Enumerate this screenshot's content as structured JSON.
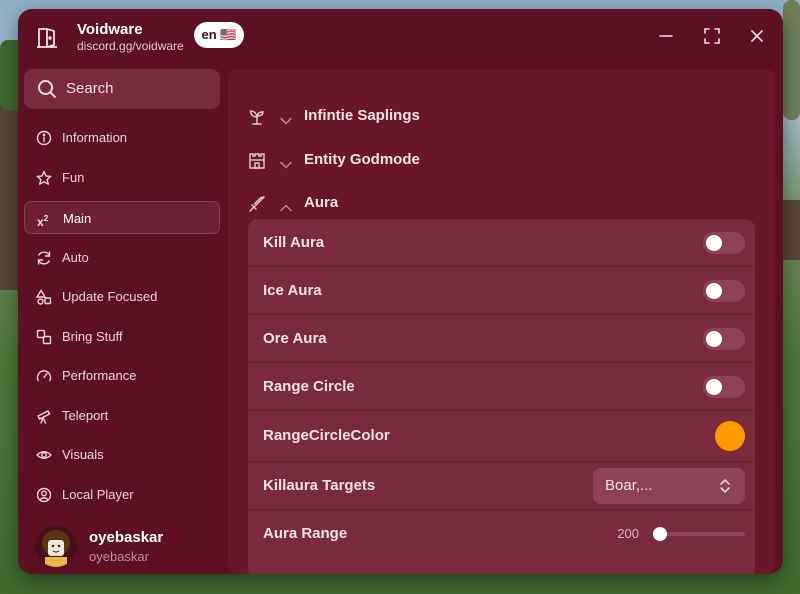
{
  "app": {
    "title": "Voidware",
    "subtitle": "discord.gg/voidware",
    "language": "en 🇺🇸"
  },
  "sidebar": {
    "search_placeholder": "Search",
    "items": [
      {
        "label": "Information",
        "icon": "info-icon"
      },
      {
        "label": "Fun",
        "icon": "star-icon"
      },
      {
        "label": "Main",
        "icon": "x2-icon",
        "active": true
      },
      {
        "label": "Auto",
        "icon": "refresh-icon"
      },
      {
        "label": "Update Focused",
        "icon": "shapes-icon"
      },
      {
        "label": "Bring Stuff",
        "icon": "boxes-icon"
      },
      {
        "label": "Performance",
        "icon": "gauge-icon"
      },
      {
        "label": "Teleport",
        "icon": "telescope-icon"
      },
      {
        "label": "Visuals",
        "icon": "eye-icon"
      },
      {
        "label": "Local Player",
        "icon": "user-circle-icon"
      }
    ],
    "user": {
      "name": "oyebaskar",
      "handle": "oyebaskar"
    }
  },
  "main": {
    "sections": [
      {
        "label": "Infintie Saplings",
        "icon": "sprout-icon",
        "expanded": false
      },
      {
        "label": "Entity Godmode",
        "icon": "castle-icon",
        "expanded": false
      },
      {
        "label": "Aura",
        "icon": "sword-icon",
        "expanded": true
      }
    ],
    "aura": {
      "kill_aura": {
        "label": "Kill Aura",
        "enabled": false
      },
      "ice_aura": {
        "label": "Ice Aura",
        "enabled": false
      },
      "ore_aura": {
        "label": "Ore Aura",
        "enabled": false
      },
      "range_circle": {
        "label": "Range Circle",
        "enabled": false
      },
      "range_circle_color": {
        "label": "RangeCircleColor",
        "color": "#ff9a00"
      },
      "killaura_targets": {
        "label": "Killaura Targets",
        "value": "Boar,..."
      },
      "aura_range": {
        "label": "Aura Range",
        "value": "200",
        "fill_fraction": 0.08
      }
    }
  },
  "colors": {
    "window_bg": "#5e1023",
    "panel_bg": "#7a2a3d",
    "accent": "#ff9a00"
  }
}
